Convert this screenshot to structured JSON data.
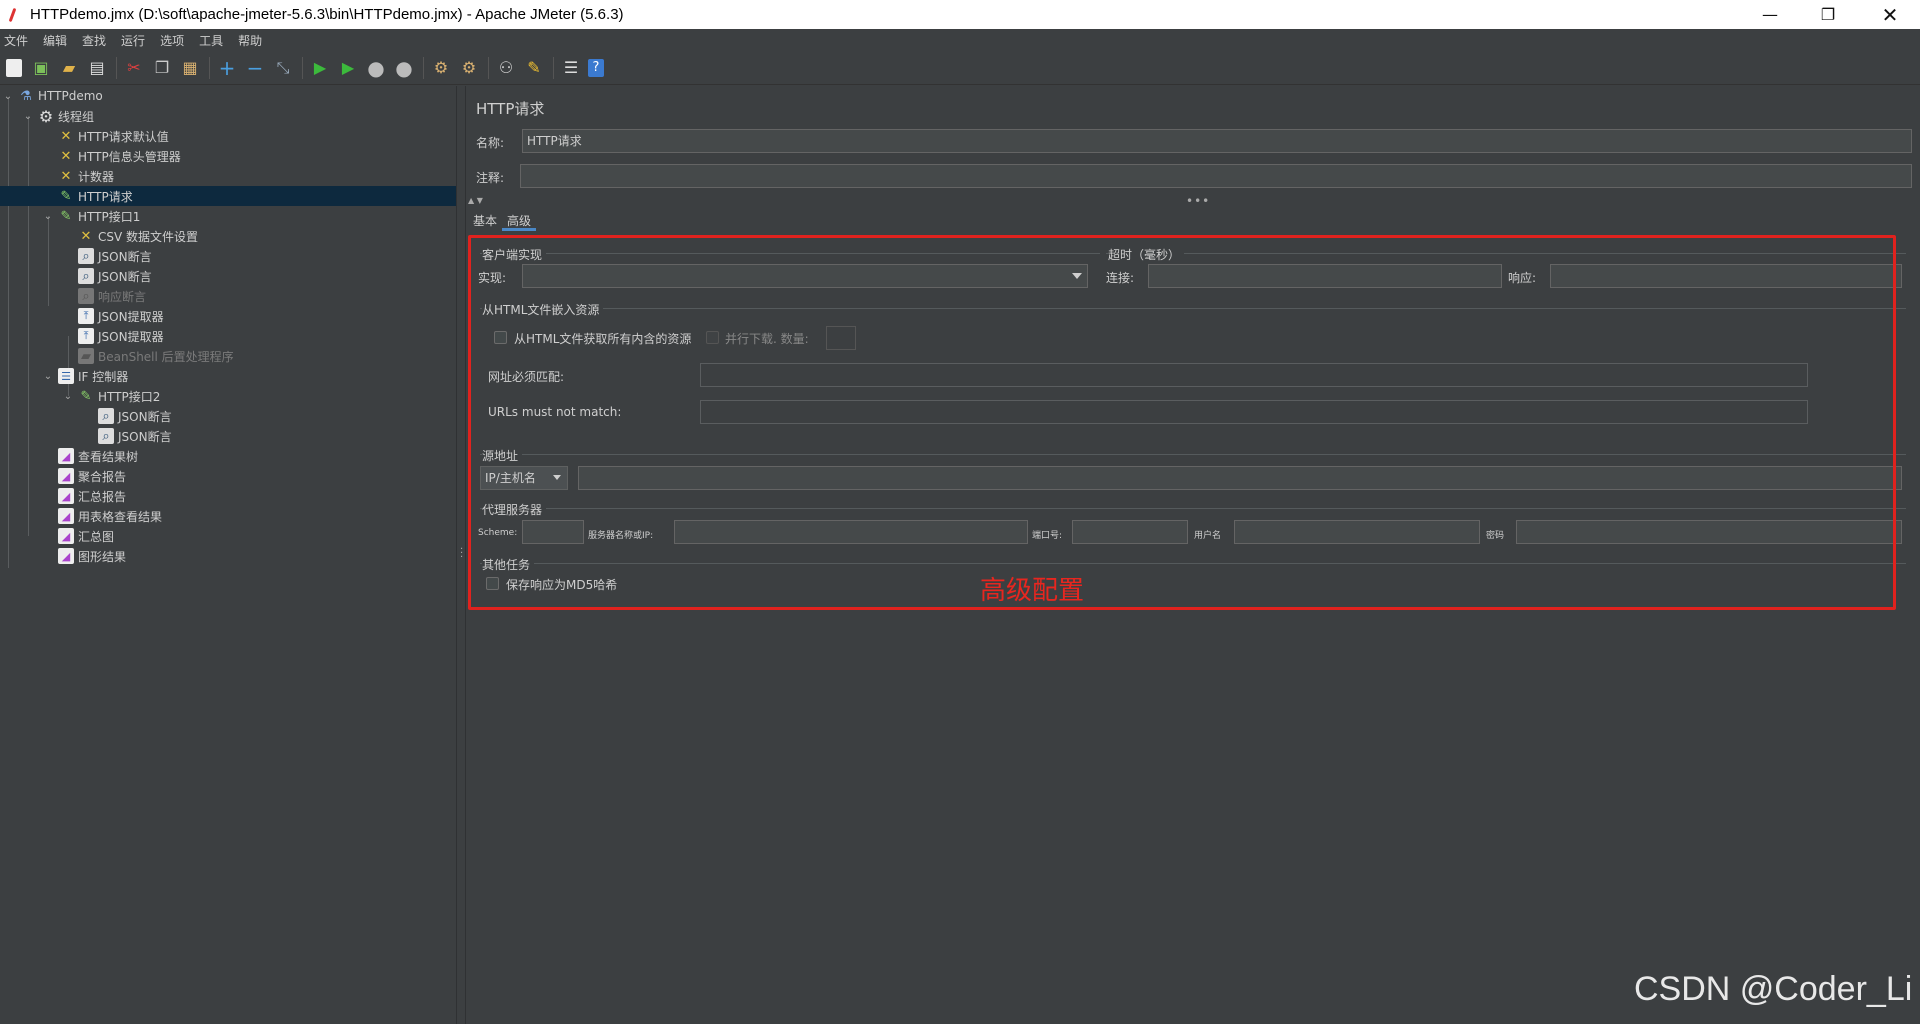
{
  "window": {
    "title": "HTTPdemo.jmx (D:\\soft\\apache-jmeter-5.6.3\\bin\\HTTPdemo.jmx) - Apache JMeter (5.6.3)",
    "minimize": "—",
    "maximize": "❐",
    "close": "✕"
  },
  "menu": [
    "文件",
    "编辑",
    "查找",
    "运行",
    "选项",
    "工具",
    "帮助"
  ],
  "toolbar": {
    "icons": [
      "new-icon",
      "templates-icon",
      "open-icon",
      "save-icon",
      "cut-icon",
      "copy-icon",
      "paste-icon",
      "expand-icon",
      "collapse-icon",
      "toggle-icon",
      "start-icon",
      "start-no-pause-icon",
      "stop-icon",
      "shutdown-icon",
      "clear-icon",
      "clear-all-icon",
      "search-icon",
      "reset-search-icon",
      "function-helper-icon",
      "help-icon"
    ]
  },
  "tree": [
    {
      "label": "HTTPdemo",
      "icon": "test-plan-icon"
    },
    {
      "label": "线程组",
      "icon": "thread-group-icon"
    },
    {
      "label": "HTTP请求默认值",
      "icon": "config-element-icon"
    },
    {
      "label": "HTTP信息头管理器",
      "icon": "config-element-icon"
    },
    {
      "label": "计数器",
      "icon": "config-element-icon"
    },
    {
      "label": "HTTP请求",
      "icon": "sampler-icon"
    },
    {
      "label": "HTTP接口1",
      "icon": "sampler-icon"
    },
    {
      "label": "CSV 数据文件设置",
      "icon": "config-element-icon"
    },
    {
      "label": "JSON断言",
      "icon": "assertion-icon"
    },
    {
      "label": "JSON断言",
      "icon": "assertion-icon"
    },
    {
      "label": "响应断言",
      "icon": "assertion-icon"
    },
    {
      "label": "JSON提取器",
      "icon": "extractor-icon"
    },
    {
      "label": "JSON提取器",
      "icon": "extractor-icon"
    },
    {
      "label": "BeanShell 后置处理程序",
      "icon": "postprocessor-icon"
    },
    {
      "label": "IF 控制器",
      "icon": "controller-icon"
    },
    {
      "label": "HTTP接口2",
      "icon": "sampler-icon"
    },
    {
      "label": "JSON断言",
      "icon": "assertion-icon"
    },
    {
      "label": "JSON断言",
      "icon": "assertion-icon"
    },
    {
      "label": "查看结果树",
      "icon": "listener-icon"
    },
    {
      "label": "聚合报告",
      "icon": "listener-icon"
    },
    {
      "label": "汇总报告",
      "icon": "listener-icon"
    },
    {
      "label": "用表格查看结果",
      "icon": "listener-icon"
    },
    {
      "label": "汇总图",
      "icon": "listener-icon"
    },
    {
      "label": "图形结果",
      "icon": "listener-icon"
    }
  ],
  "panel": {
    "title": "HTTP请求",
    "name_label": "名称:",
    "name_value": "HTTP请求",
    "comment_label": "注释:",
    "comment_value": "",
    "tabs": [
      "基本",
      "高级"
    ],
    "active_tab": "高级"
  },
  "advanced": {
    "client_impl_section": "客户端实现",
    "impl_label": "实现:",
    "impl_value": "",
    "timeout_section": "超时（毫秒）",
    "connect_label": "连接:",
    "connect_value": "",
    "response_label": "响应:",
    "response_value": "",
    "embedded_section": "从HTML文件嵌入资源",
    "retrieve_all_label": "从HTML文件获取所有内含的资源",
    "parallel_label": "并行下载. 数量:",
    "parallel_value": "",
    "url_match_label": "网址必须匹配:",
    "url_match_value": "",
    "url_not_match_label": "URLs must not match:",
    "url_not_match_value": "",
    "source_section": "源地址",
    "source_type": "IP/主机名",
    "source_value": "",
    "proxy_section": "代理服务器",
    "scheme_label": "Scheme:",
    "server_label": "服务器名称或IP:",
    "port_label": "端口号:",
    "username_label": "用户名",
    "password_label": "密码",
    "other_section": "其他任务",
    "md5_label": "保存响应为MD5哈希"
  },
  "annotation": "高级配置",
  "watermark": "CSDN @Coder_Li",
  "colors": {
    "background": "#3c3f41",
    "selection": "#0d293e",
    "highlight_box": "#e0221e",
    "tab_underline": "#4a88c7"
  }
}
